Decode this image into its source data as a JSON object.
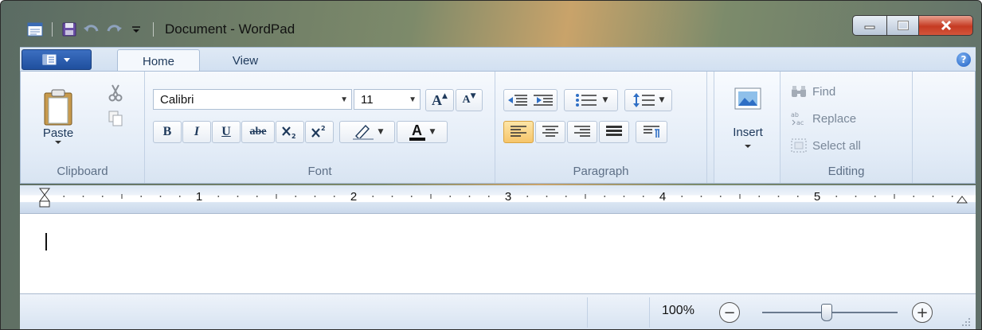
{
  "window": {
    "title": "Document - WordPad"
  },
  "tabs": {
    "home": "Home",
    "view": "View",
    "help_symbol": "?"
  },
  "ribbon": {
    "clipboard": {
      "label": "Clipboard",
      "paste": "Paste"
    },
    "font": {
      "label": "Font",
      "family_value": "Calibri",
      "size_value": "11",
      "bold": "B",
      "italic": "I",
      "underline": "U",
      "strikethrough": "abe",
      "grow": "A",
      "shrink": "A",
      "color_letter": "A"
    },
    "paragraph": {
      "label": "Paragraph"
    },
    "insert": {
      "label": "Insert"
    },
    "editing": {
      "label": "Editing",
      "find": "Find",
      "replace": "Replace",
      "select_all": "Select all"
    }
  },
  "ruler": {
    "numbers": [
      "1",
      "2",
      "3",
      "4",
      "5"
    ]
  },
  "status": {
    "zoom": "100%"
  },
  "colors": {
    "accent": "#1f4f9e",
    "ribbon_bg": "#e3ecf7",
    "close_red": "#c53a22",
    "highlight_orange": "#f6c56a"
  }
}
